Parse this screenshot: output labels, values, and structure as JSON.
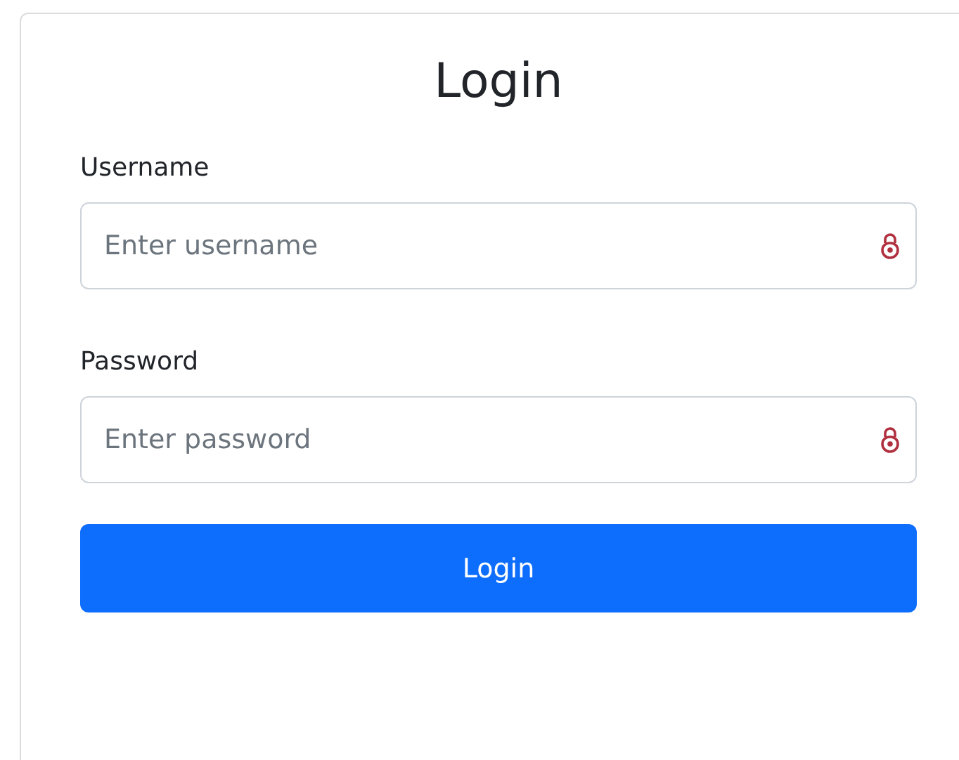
{
  "title": "Login",
  "fields": [
    {
      "label": "Username",
      "placeholder": "Enter username"
    },
    {
      "label": "Password",
      "placeholder": "Enter password"
    }
  ],
  "button": "Login"
}
